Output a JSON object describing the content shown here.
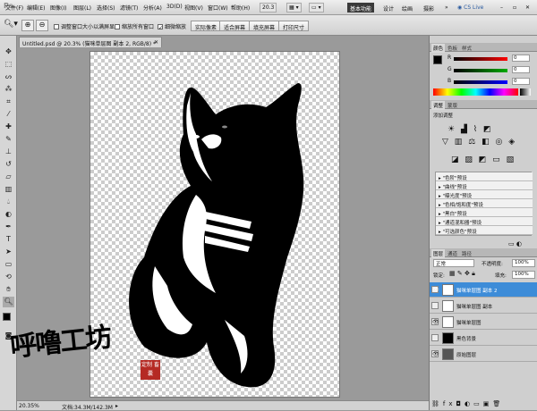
{
  "app": {
    "logo": "Ps"
  },
  "menu": [
    "文件(F)",
    "编辑(E)",
    "图像(I)",
    "图层(L)",
    "选择(S)",
    "滤镜(T)",
    "分析(A)",
    "3D(D)",
    "视图(V)",
    "窗口(W)",
    "帮助(H)"
  ],
  "menubar_controls": {
    "zoom_value": "20.3",
    "workspaces": [
      "基本功能",
      "设计",
      "绘画",
      "摄影"
    ],
    "more": "»",
    "cs_live": "CS Live"
  },
  "options_bar": {
    "resize_windows": "调整窗口大小以满屏显示",
    "zoom_all": "缩放所有窗口",
    "scrubby_zoom": "细微缩放",
    "actual_pixels": "实际像素",
    "fit_screen": "适合屏幕",
    "fill_screen": "填充屏幕",
    "print_size": "打印尺寸"
  },
  "document": {
    "tab_title": "Untitled.psd @ 20.3% (猫咪单层图 副本 2, RGB/8) *",
    "zoom_status": "20.35%",
    "doc_size": "文档:34.3M/142.3M"
  },
  "panels": {
    "color": {
      "tabs": [
        "颜色",
        "色板",
        "样式"
      ],
      "channels": [
        {
          "label": "R",
          "value": "0"
        },
        {
          "label": "G",
          "value": "0"
        },
        {
          "label": "B",
          "value": "0"
        }
      ]
    },
    "adjustments": {
      "tabs": [
        "调整",
        "蒙版"
      ],
      "title": "添加调整",
      "presets": [
        "\"色阶\"预设",
        "\"曲线\"预设",
        "\"曝光度\"预设",
        "\"色相/饱和度\"预设",
        "\"黑白\"预设",
        "\"通道混和器\"预设",
        "\"可选颜色\"预设"
      ]
    },
    "layers": {
      "tabs": [
        "图层",
        "通道",
        "路径"
      ],
      "blend_mode": "正常",
      "opacity_label": "不透明度:",
      "opacity": "100%",
      "lock_label": "锁定:",
      "fill_label": "填充:",
      "fill": "100%",
      "items": [
        {
          "name": "猫咪单层图 副本 2",
          "selected": true
        },
        {
          "name": "猫咪单层图 副本",
          "selected": false
        },
        {
          "name": "猫咪单层图",
          "selected": false
        },
        {
          "name": "黑色背景",
          "selected": false
        },
        {
          "name": "原始图层",
          "selected": false
        }
      ]
    }
  },
  "watermark": {
    "text": "呼噜工坊",
    "seal": "定制 畜囊"
  },
  "colors": {
    "selected_layer": "#3d8cd8",
    "foreground": "#000000",
    "background": "#ffffff"
  }
}
